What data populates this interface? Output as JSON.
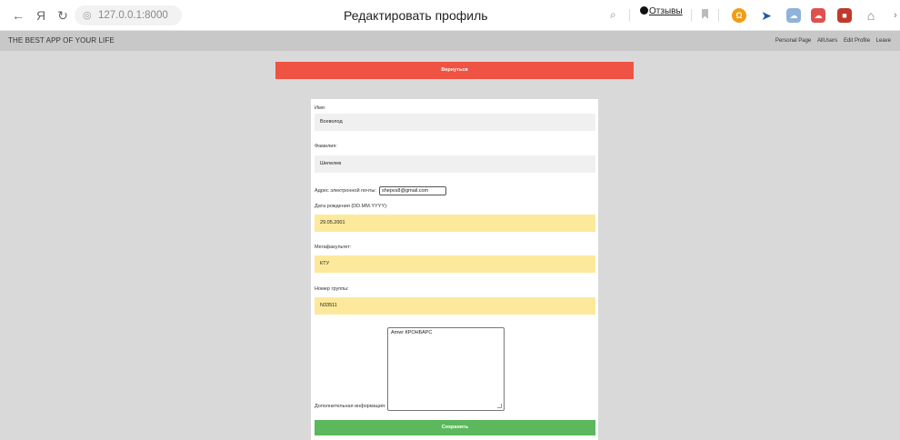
{
  "browser": {
    "url": "127.0.0.1:8000",
    "tab_title": "Редактировать профиль",
    "reviews_label": "Отзывы"
  },
  "header": {
    "brand": "THE BEST APP OF YOUR LIFE",
    "nav": [
      "Personal Page",
      "AllUsers",
      "Edit Profile",
      "Leave"
    ]
  },
  "back_button": "Вернуться",
  "form": {
    "first_name_label": "Имя:",
    "first_name_value": "Всеволод",
    "last_name_label": "Фамилия:",
    "last_name_value": "Шепелев",
    "email_label": "Адрес электронной почты:",
    "email_value": "shepvs8@gmail.com",
    "birth_label": "Дата рождения (DD.MM.YYYY):",
    "birth_value": "29.05.2001",
    "faculty_label": "Мегафакультет:",
    "faculty_value": "КТУ",
    "group_label": "Номер группы:",
    "group_value": "N33511",
    "info_label": "Дополнительная информация:",
    "info_value": "Amwr КРОНБАРС",
    "save_button": "Сохранить"
  }
}
